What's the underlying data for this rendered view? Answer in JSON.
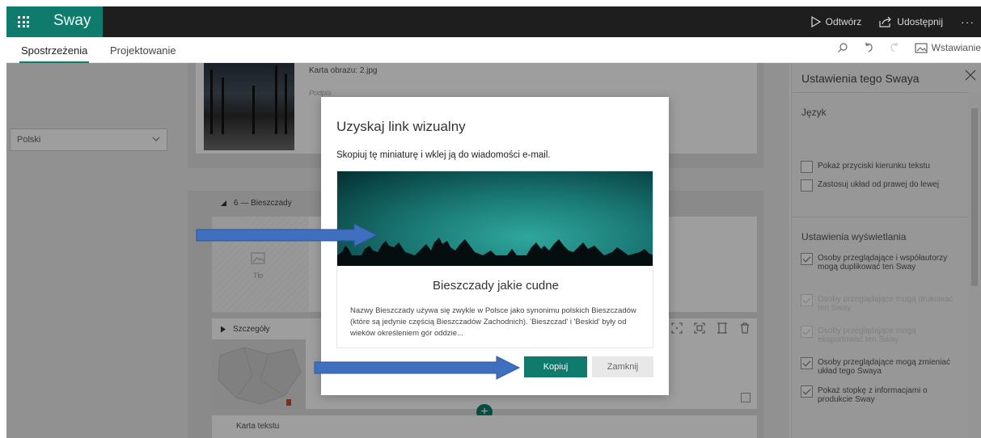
{
  "app": {
    "name": "Sway",
    "play_label": "Odtwórz",
    "share_label": "Udostępnij",
    "more_label": "···"
  },
  "tabs": [
    {
      "label": "Spostrzeżenia",
      "active": true
    },
    {
      "label": "Projektowanie",
      "active": false
    }
  ],
  "toolbar": {
    "insert_label": "Wstawianie"
  },
  "canvas": {
    "image_card_title": "Karta obrazu: 2.jpg",
    "image_card_caption": "Podpis",
    "section_label": "6 — Bieszczady",
    "background_label": "Tło",
    "details_label": "Szczegóły",
    "text_card_title": "Karta tekstu"
  },
  "panel": {
    "title": "Ustawienia tego Swaya",
    "language_label": "Język",
    "language_value": "Polski",
    "options_a": [
      {
        "label": "Pokaż przyciski kierunku tekstu",
        "checked": false,
        "disabled": false
      },
      {
        "label": "Zastosuj układ od prawej do lewej",
        "checked": false,
        "disabled": false
      }
    ],
    "display_settings_label": "Ustawienia wyświetlania",
    "options_b": [
      {
        "label": "Osoby przeglądające i współautorzy mogą duplikować ten Sway",
        "checked": true,
        "disabled": false
      },
      {
        "label": "Osoby przeglądające mogą drukować ten Sway",
        "checked": true,
        "disabled": true
      },
      {
        "label": "Osoby przeglądające mogą eksportować ten Sway",
        "checked": true,
        "disabled": true
      },
      {
        "label": "Osoby przeglądające mogą zmieniać układ tego Swaya",
        "checked": true,
        "disabled": false
      },
      {
        "label": "Pokaż stopkę z informacjami o produkcie Sway",
        "checked": true,
        "disabled": false
      }
    ]
  },
  "dialog": {
    "title": "Uzyskaj link wizualny",
    "description": "Skopiuj tę miniaturę i wklej ją do wiadomości e-mail.",
    "preview_title": "Bieszczady jakie cudne",
    "preview_text": "Nazwy Bieszczady używa się zwykle w Polsce jako synonimu polskich Bieszczadów (które są jedynie częścią Bieszczadów Zachodnich). 'Bieszczad' i 'Beskid' były od wieków określeniem gór oddzie...",
    "copy_button": "Kopiuj",
    "close_button": "Zamknij"
  },
  "colors": {
    "brand": "#0f7b6c",
    "topbar": "#1e1e1e",
    "arrow": "#3f6fbf"
  }
}
